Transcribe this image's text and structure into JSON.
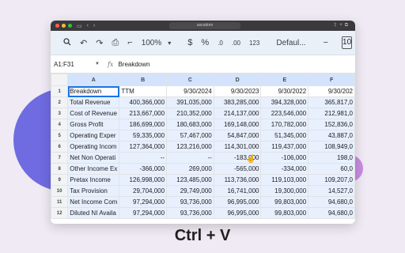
{
  "window": {
    "address": "ascodom"
  },
  "toolbar": {
    "zoom": "100%",
    "currency": "$",
    "percent": "%",
    "decimal_decrease": ".0",
    "decimal_increase": ".00",
    "number_format": "123",
    "font": "Defaul...",
    "font_decrease": "−",
    "font_size": "10",
    "font_increase": "+"
  },
  "formula_bar": {
    "name_box": "A1:F31",
    "fx": "fx",
    "content": "Breakdown"
  },
  "columns": [
    "A",
    "B",
    "C",
    "D",
    "E",
    "F"
  ],
  "rows": [
    {
      "num": "1",
      "cells": [
        "Breakdown",
        "TTM",
        "9/30/2024",
        "9/30/2023",
        "9/30/2022",
        "9/30/202"
      ]
    },
    {
      "num": "2",
      "cells": [
        "Total Revenue",
        "400,366,000",
        "391,035,000",
        "383,285,000",
        "394,328,000",
        "365,817,0"
      ]
    },
    {
      "num": "3",
      "cells": [
        "Cost of Revenue",
        "213,667,000",
        "210,352,000",
        "214,137,000",
        "223,546,000",
        "212,981,0"
      ]
    },
    {
      "num": "4",
      "cells": [
        "Gross Profit",
        "186,699,000",
        "180,683,000",
        "169,148,000",
        "170,782,000",
        "152,836,0"
      ]
    },
    {
      "num": "5",
      "cells": [
        "Operating Exper",
        "59,335,000",
        "57,467,000",
        "54,847,000",
        "51,345,000",
        "43,887,0"
      ]
    },
    {
      "num": "6",
      "cells": [
        "Operating Incom",
        "127,364,000",
        "123,216,000",
        "114,301,000",
        "119,437,000",
        "108,949,0"
      ]
    },
    {
      "num": "7",
      "cells": [
        "Net Non Operati",
        "--",
        "--",
        "-183,000",
        "-106,000",
        "198,0"
      ]
    },
    {
      "num": "8",
      "cells": [
        "Other Income Ex",
        "-366,000",
        "269,000",
        "-565,000",
        "-334,000",
        "60,0"
      ]
    },
    {
      "num": "9",
      "cells": [
        "Pretax Income",
        "126,998,000",
        "123,485,000",
        "113,736,000",
        "119,103,000",
        "109,207,0"
      ]
    },
    {
      "num": "10",
      "cells": [
        "Tax Provision",
        "29,704,000",
        "29,749,000",
        "16,741,000",
        "19,300,000",
        "14,527,0"
      ]
    },
    {
      "num": "11",
      "cells": [
        "Net Income Com",
        "97,294,000",
        "93,736,000",
        "96,995,000",
        "99,803,000",
        "94,680,0"
      ]
    },
    {
      "num": "12",
      "cells": [
        "Diluted NI Availa",
        "97,294,000",
        "93,736,000",
        "96,995,000",
        "99,803,000",
        "94,680,0"
      ]
    }
  ],
  "caption": "Ctrl + V"
}
